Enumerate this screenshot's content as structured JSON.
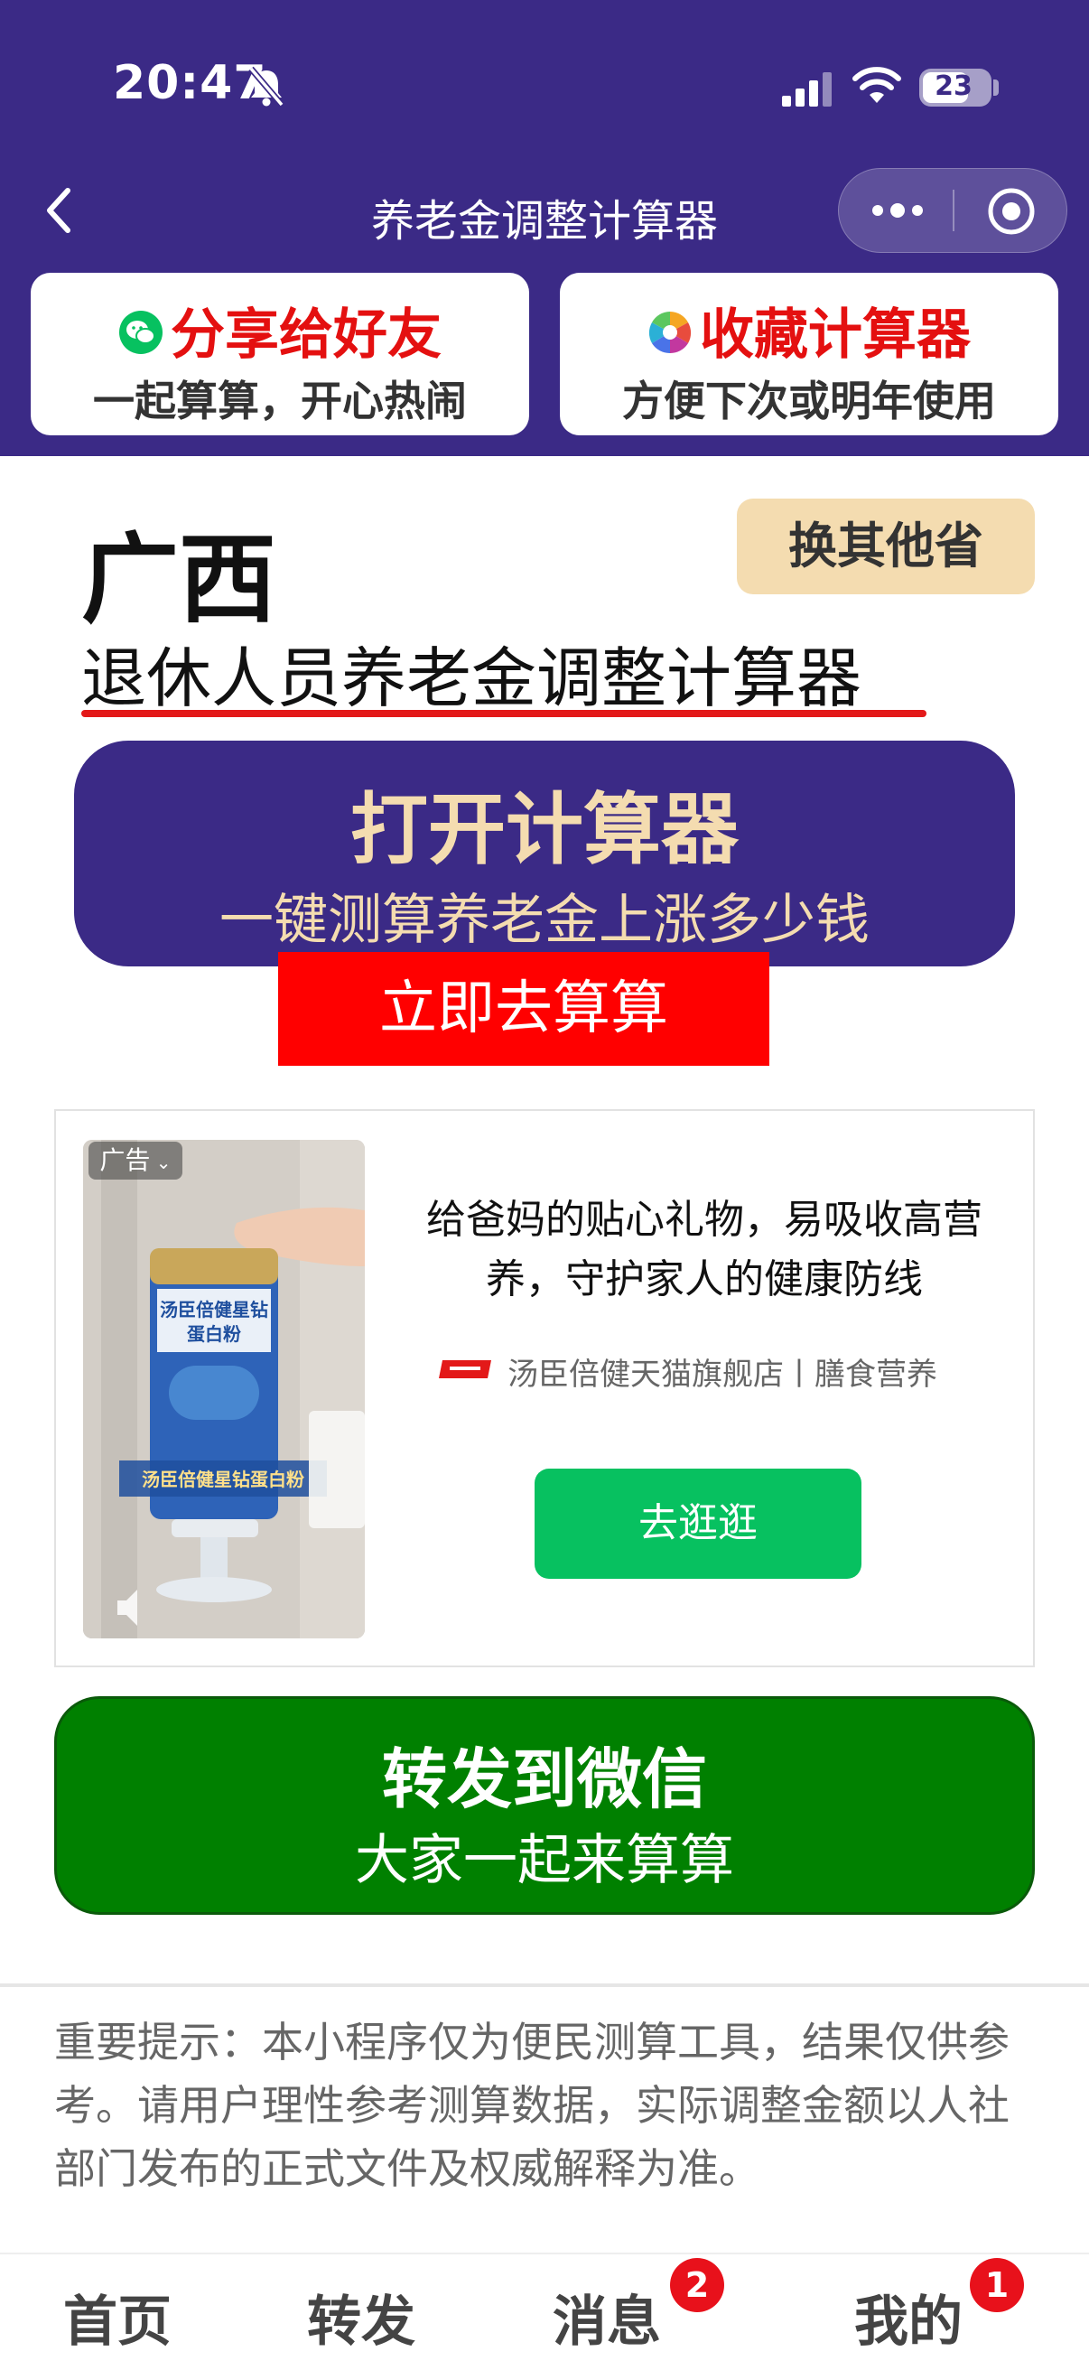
{
  "status_bar": {
    "time": "20:47",
    "battery": "23"
  },
  "nav": {
    "title": "养老金调整计算器"
  },
  "promo": {
    "share": {
      "title": "分享给好友",
      "subtitle": "一起算算，开心热闹"
    },
    "favorite": {
      "title": "收藏计算器",
      "subtitle": "方便下次或明年使用"
    }
  },
  "main": {
    "province": "广西",
    "change_province": "换其他省",
    "calculator_title": "退休人员养老金调整计算器",
    "open_calc": {
      "title": "打开计算器",
      "subtitle": "一键测算养老金上涨多少钱"
    },
    "go_calc": "立即去算算"
  },
  "ad": {
    "tag": "广告",
    "text": "给爸妈的贴心礼物，易吸收高营养，守护家人的健康防线",
    "brand": "汤臣倍健天猫旗舰店丨膳食营养",
    "button": "去逛逛",
    "image_caption": "汤臣倍健星钻蛋白粉",
    "can_label": "汤臣倍健星钻蛋白粉"
  },
  "share": {
    "title": "转发到微信",
    "subtitle": "大家一起来算算"
  },
  "notice": "重要提示：本小程序仅为便民测算工具，结果仅供参考。请用户理性参考测算数据，实际调整金额以人社部门发布的正式文件及权威解释为准。",
  "tabs": [
    {
      "label": "首页"
    },
    {
      "label": "转发"
    },
    {
      "label": "消息",
      "badge": "2"
    },
    {
      "label": "我的",
      "badge": "1"
    }
  ],
  "colors": {
    "header_bg": "#3b2a86",
    "accent_gold": "#f4dcb0",
    "red": "#ff0000",
    "green": "#008000",
    "wechat_green": "#07c160"
  }
}
